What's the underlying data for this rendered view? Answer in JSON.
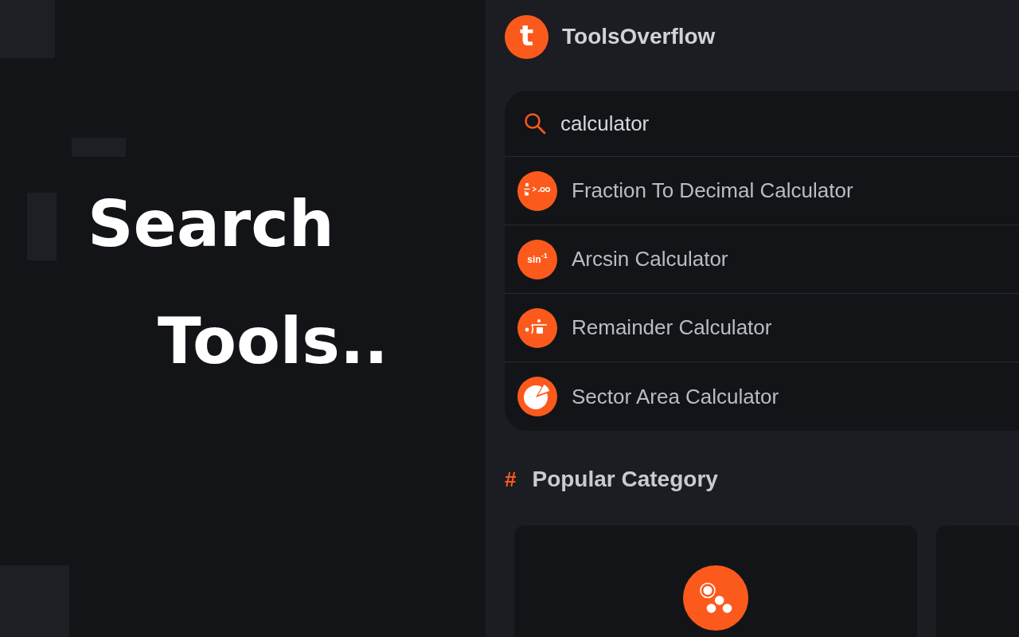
{
  "promo": {
    "headline": [
      "Search",
      "Tools.."
    ]
  },
  "header": {
    "logo_letter": "t",
    "title": "ToolsOverflow"
  },
  "search": {
    "value": "calculator",
    "results": [
      {
        "kind": "fraction",
        "label": "Fraction To Decimal Calculator"
      },
      {
        "kind": "arcsin",
        "label": "Arcsin Calculator",
        "icon_text": "sin$^{-1}$"
      },
      {
        "kind": "remainder",
        "label": "Remainder Calculator"
      },
      {
        "kind": "sector",
        "label": "Sector Area Calculator"
      }
    ]
  },
  "popular_category": {
    "marker": "#",
    "title": "Popular Category",
    "cards": [
      {
        "kind": "dots"
      },
      {
        "kind": "cut_off"
      }
    ]
  }
}
